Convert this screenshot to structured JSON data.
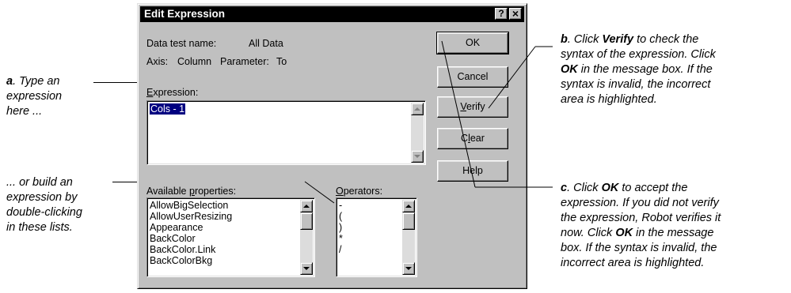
{
  "dialog": {
    "title": "Edit Expression",
    "help_glyph": "?",
    "close_glyph": "×",
    "data_test_name_label": "Data test name:",
    "data_test_name_value": "All Data",
    "axis_label": "Axis:",
    "axis_value": "Column",
    "parameter_label": "Parameter:",
    "parameter_value": "To",
    "expression_label_first": "E",
    "expression_label_rest": "xpression:",
    "expression_value": "Cols - 1",
    "available_label_pre": "Available ",
    "available_label_u": "p",
    "available_label_post": "roperties:",
    "operators_label_u": "O",
    "operators_label_rest": "perators:",
    "properties": [
      "AllowBigSelection",
      "AllowUserResizing",
      "Appearance",
      "BackColor",
      "BackColor.Link",
      "BackColorBkg"
    ],
    "operators": [
      "-",
      "(",
      ")",
      "*",
      "/"
    ],
    "buttons": {
      "ok": "OK",
      "cancel": "Cancel",
      "verify_u": "V",
      "verify_rest": "erify",
      "clear_pre": "C",
      "clear_u": "l",
      "clear_post": "ear",
      "help": "Help"
    }
  },
  "annotations": {
    "a_letter": "a",
    "a_text": ". Type an expression here ...",
    "a_line1_rest": ". Type an",
    "a_line2": "expression",
    "a_line3": "here ...",
    "d_line1": "... or build an",
    "d_line2": "expression by",
    "d_line3": "double-clicking",
    "d_line4": "in these lists.",
    "b_letter": "b",
    "b_l1_pre": ". Click ",
    "b_l1_bold": "Verify",
    "b_l1_post": " to check the",
    "b_l2": "syntax of the expression. Click",
    "b_l3_bold": "OK",
    "b_l3_post": " in the message box. If the",
    "b_l4": "syntax is invalid, the incorrect",
    "b_l5": "area is highlighted.",
    "c_letter": "c",
    "c_l1_pre": ". Click ",
    "c_l1_bold": "OK",
    "c_l1_post": " to accept the",
    "c_l2": "expression. If you did not verify",
    "c_l3": "the expression, Robot verifies it",
    "c_l4_pre": "now. Click ",
    "c_l4_bold": "OK",
    "c_l4_post": " in the message",
    "c_l5": "box. If the syntax is invalid, the",
    "c_l6": "incorrect area is highlighted."
  }
}
